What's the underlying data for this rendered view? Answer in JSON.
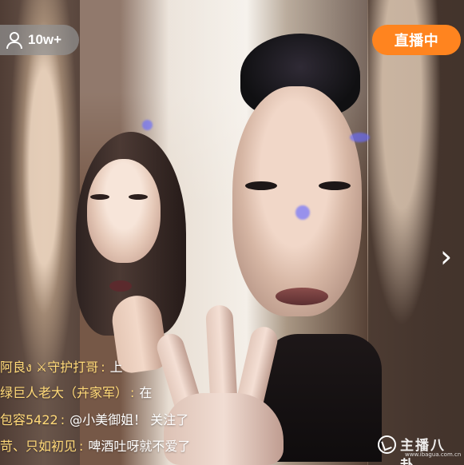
{
  "stream": {
    "viewer_count": "10w+",
    "live_status": "直播中",
    "next_icon": "chevron-right-icon"
  },
  "comments": [
    {
      "name": "阿良ง ⚔守护打哥",
      "text": "上"
    },
    {
      "name": "绿巨人老大（卉家军）",
      "text": "在"
    },
    {
      "name": "包容5422",
      "text": "@小美御姐！ 关注了"
    },
    {
      "name": "苛、只如初见",
      "text": "啤酒吐呀就不爱了"
    }
  ],
  "watermark": {
    "brand": "主播八卦",
    "url": "www.ibagua.com.cn"
  },
  "colors": {
    "live_badge": "#ff841f",
    "comment_name": "#ffd978",
    "comment_text": "#ffffff"
  }
}
